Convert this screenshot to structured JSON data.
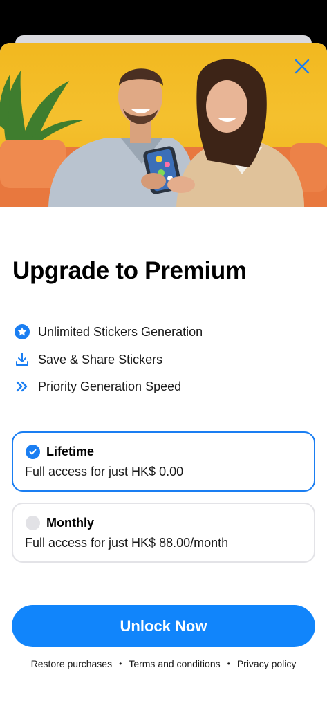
{
  "hero": {
    "close_icon": "close-icon",
    "accent": "#1a7ef2"
  },
  "title": "Upgrade to Premium",
  "features": [
    {
      "icon": "star-badge-icon",
      "label": "Unlimited Stickers Generation"
    },
    {
      "icon": "download-icon",
      "label": "Save & Share Stickers"
    },
    {
      "icon": "double-chevron-right-icon",
      "label": "Priority Generation Speed"
    }
  ],
  "plans": [
    {
      "title": "Lifetime",
      "description": "Full access for just HK$ 0.00",
      "selected": true
    },
    {
      "title": "Monthly",
      "description": "Full access for just HK$ 88.00/month",
      "selected": false
    }
  ],
  "cta": {
    "label": "Unlock Now",
    "color": "#1185fb"
  },
  "footer": {
    "restore": "Restore purchases",
    "terms": "Terms and conditions",
    "privacy": "Privacy policy",
    "separator": "•"
  }
}
